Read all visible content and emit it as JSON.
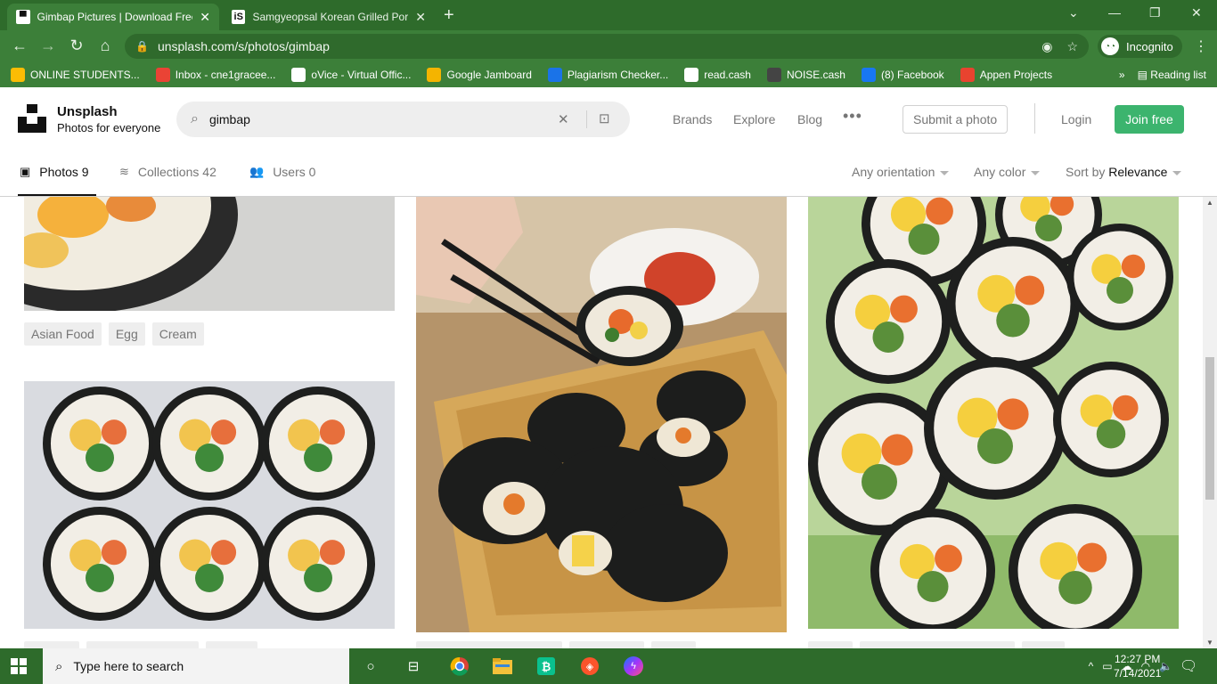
{
  "browser": {
    "tabs": [
      {
        "title": "Gimbap Pictures | Download Free",
        "active": true
      },
      {
        "title": "Samgyeopsal Korean Grilled Pork",
        "active": false
      }
    ],
    "url": "unsplash.com/s/photos/gimbap",
    "incognito_label": "Incognito",
    "bookmarks": [
      {
        "label": "ONLINE STUDENTS...",
        "icon": "drive-icon",
        "color": "#fbbc04"
      },
      {
        "label": "Inbox - cne1gracee...",
        "icon": "gmail-icon",
        "color": "#ea4335"
      },
      {
        "label": "oVice - Virtual Offic...",
        "icon": "ovice-icon",
        "color": "#ffffff"
      },
      {
        "label": "Google Jamboard",
        "icon": "jamboard-icon",
        "color": "#f4b400"
      },
      {
        "label": "Plagiarism Checker...",
        "icon": "plagiarism-icon",
        "color": "#1a73e8"
      },
      {
        "label": "read.cash",
        "icon": "readcash-icon",
        "color": "#ffffff"
      },
      {
        "label": "NOISE.cash",
        "icon": "noisecash-icon",
        "color": "#444444"
      },
      {
        "label": "(8) Facebook",
        "icon": "facebook-icon",
        "color": "#1877f2"
      },
      {
        "label": "Appen Projects",
        "icon": "appen-icon",
        "color": "#e8432f"
      }
    ],
    "reading_list": "Reading list"
  },
  "header": {
    "brand_name": "Unsplash",
    "brand_tagline": "Photos for everyone",
    "search_query": "gimbap",
    "nav": [
      "Brands",
      "Explore",
      "Blog"
    ],
    "submit_label": "Submit a photo",
    "login_label": "Login",
    "join_label": "Join free"
  },
  "subnav": {
    "photos_label": "Photos",
    "photos_count": "9",
    "collections_label": "Collections",
    "collections_count": "42",
    "users_label": "Users",
    "users_count": "0",
    "orientation": "Any orientation",
    "color": "Any color",
    "sort_prefix": "Sort by",
    "sort_value": "Relevance"
  },
  "content": {
    "tags_row1": [
      "Asian Food",
      "Egg",
      "Cream"
    ]
  },
  "taskbar": {
    "search_placeholder": "Type here to search",
    "time": "12:27 PM",
    "date": "7/14/2021"
  },
  "colors": {
    "chrome_green": "#3c7f39",
    "join_green": "#3cb46e"
  }
}
